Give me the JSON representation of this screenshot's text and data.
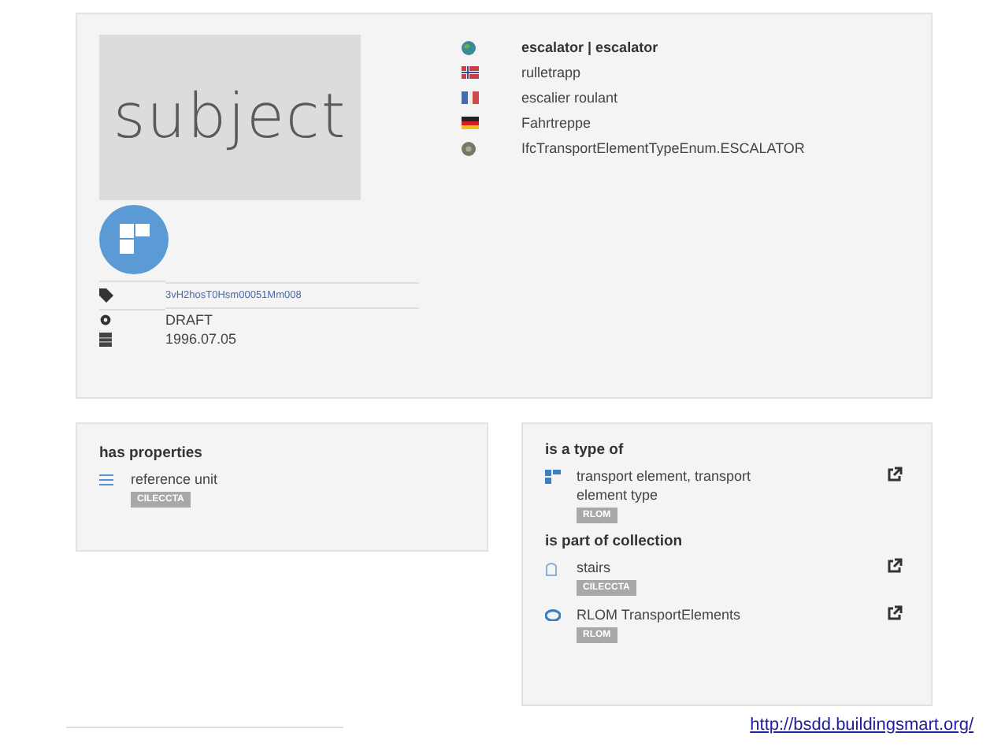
{
  "subject": {
    "image_label": "subject",
    "names": [
      {
        "kind": "globe",
        "text": "escalator | escalator",
        "bold": true
      },
      {
        "kind": "norway",
        "text": "rulletrapp",
        "bold": false
      },
      {
        "kind": "france",
        "text": "escalier roulant",
        "bold": false
      },
      {
        "kind": "germany",
        "text": "Fahrtreppe",
        "bold": false
      },
      {
        "kind": "ifc",
        "text": "IfcTransportElementTypeEnum.ESCALATOR",
        "bold": false
      }
    ],
    "meta": [
      {
        "kind": "guid",
        "text": "3vH2hosT0Hsm00051Mm008"
      },
      {
        "kind": "status",
        "text": "DRAFT"
      },
      {
        "kind": "date",
        "text": "1996.07.05"
      }
    ]
  },
  "properties": {
    "title": "has properties",
    "items": [
      {
        "kind": "list",
        "name": "reference unit",
        "badge": "CILECCTA",
        "external": false
      }
    ]
  },
  "relations": [
    {
      "title": "is a type of",
      "items": [
        {
          "kind": "type",
          "name": "transport element, transport element type",
          "badge": "RLOM",
          "external": true
        }
      ]
    },
    {
      "title": "is part of collection",
      "items": [
        {
          "kind": "stairs",
          "name": "stairs",
          "badge": "CILECCTA",
          "external": true
        },
        {
          "kind": "collection",
          "name": "RLOM TransportElements",
          "badge": "RLOM",
          "external": true
        }
      ]
    }
  ],
  "footer": {
    "link": "http://bsdd.buildingsmart.org/"
  }
}
